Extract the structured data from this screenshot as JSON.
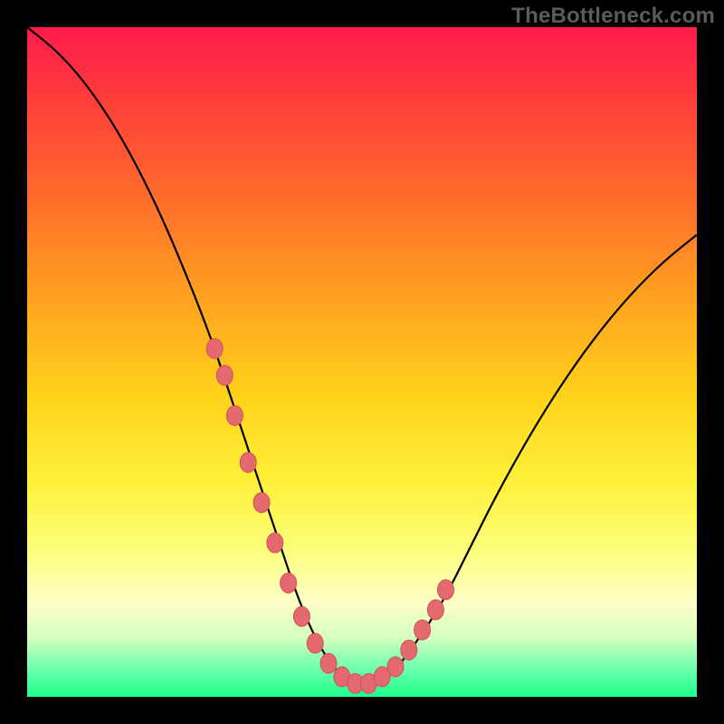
{
  "watermark": "TheBottleneck.com",
  "chart_data": {
    "type": "line",
    "title": "",
    "xlabel": "",
    "ylabel": "",
    "xlim": [
      0,
      100
    ],
    "ylim": [
      0,
      100
    ],
    "grid": false,
    "legend": false,
    "background": "rainbow-gradient",
    "series": [
      {
        "name": "curve",
        "color": "#000000",
        "x": [
          0,
          5,
          10,
          15,
          20,
          25,
          28,
          30,
          32,
          34,
          36,
          38,
          40,
          42,
          44,
          46,
          48,
          50,
          52,
          55,
          58,
          62,
          66,
          70,
          75,
          80,
          85,
          90,
          95,
          100
        ],
        "y": [
          100,
          96,
          90,
          82,
          72,
          60,
          52,
          46,
          40,
          34,
          28,
          22,
          16,
          11,
          7,
          4,
          2.5,
          2,
          2.5,
          4,
          8,
          14,
          22,
          30,
          39,
          47,
          54,
          60,
          65,
          69
        ]
      },
      {
        "name": "markers",
        "type": "scatter",
        "color": "#e46a6f",
        "x": [
          28,
          29.5,
          31,
          33,
          35,
          37,
          39,
          41,
          43,
          45,
          47,
          49,
          51,
          53,
          55,
          57,
          59,
          61,
          62.5
        ],
        "y": [
          52,
          48,
          42,
          35,
          29,
          23,
          17,
          12,
          8,
          5,
          3,
          2,
          2,
          3,
          4.5,
          7,
          10,
          13,
          16
        ]
      }
    ],
    "notes": "Values are visual estimates; chart has no axes, ticks, or labels. Background is a red→yellow→green vertical gradient framed by a thick black border."
  }
}
